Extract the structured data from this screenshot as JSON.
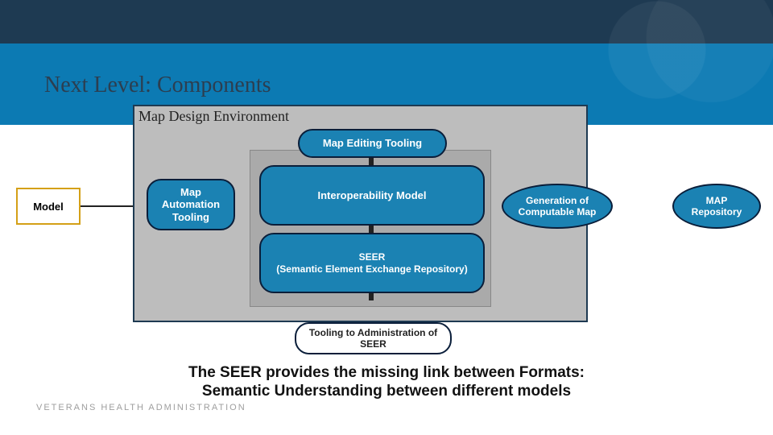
{
  "title": "Next Level: Components",
  "env_title": "Map Design Environment",
  "boxes": {
    "model": "Model",
    "map_editing": "Map Editing Tooling",
    "map_automation": "Map\nAutomation\nTooling",
    "interop": "Interoperability Model",
    "seer": "SEER\n(Semantic Element Exchange Repository)",
    "tooling_admin": "Tooling to Administration of\nSEER",
    "generation": "Generation of\nComputable Map",
    "repo": "MAP\nRepository"
  },
  "caption": "The SEER provides the missing link between Formats:\nSemantic Understanding between different models",
  "footer": "VETERANS HEALTH ADMINISTRATION"
}
